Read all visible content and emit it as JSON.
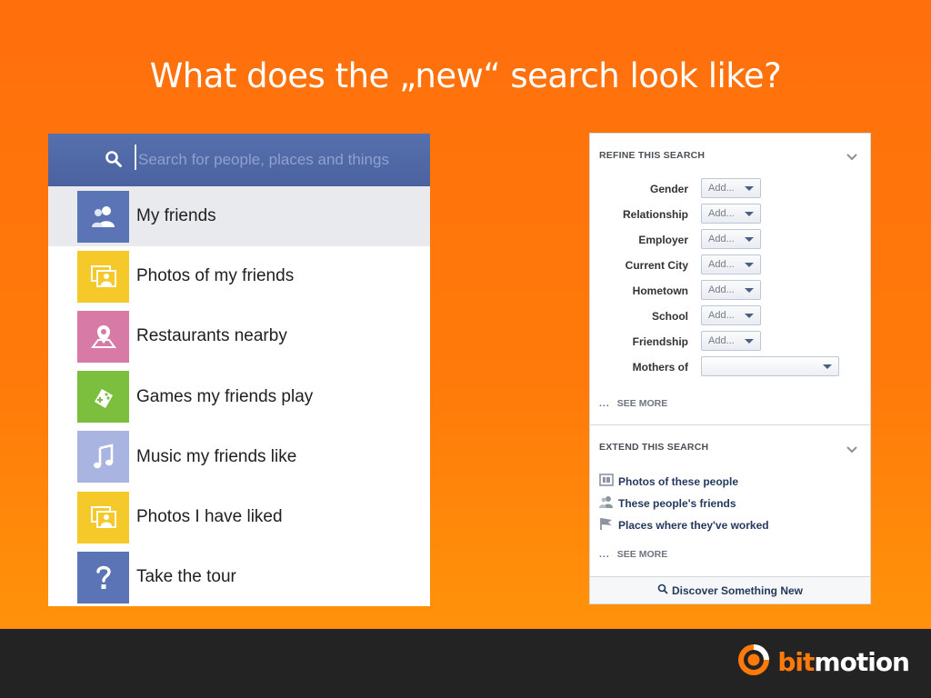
{
  "slide": {
    "title": "What does the „new“ search look like?"
  },
  "left_panel": {
    "search": {
      "placeholder": "Search for people, places and things",
      "value": ""
    },
    "results": [
      {
        "label": "My friends",
        "icon": "friends-icon",
        "color": "#5b74b5",
        "selected": true
      },
      {
        "label": "Photos of my friends",
        "icon": "photos-icon",
        "color": "#f5c92a",
        "selected": false
      },
      {
        "label": "Restaurants nearby",
        "icon": "map-pin-icon",
        "color": "#d77aa5",
        "selected": false
      },
      {
        "label": "Games my friends play",
        "icon": "game-controller-icon",
        "color": "#7cbf3f",
        "selected": false
      },
      {
        "label": "Music my friends like",
        "icon": "music-note-icon",
        "color": "#a9b4e0",
        "selected": false
      },
      {
        "label": "Photos I have liked",
        "icon": "photos-icon",
        "color": "#f5c92a",
        "selected": false
      },
      {
        "label": "Take the tour",
        "icon": "question-icon",
        "color": "#5b74b5",
        "selected": false
      }
    ]
  },
  "right_panel": {
    "refine": {
      "title": "REFINE THIS SEARCH",
      "filters": [
        {
          "label": "Gender",
          "value": "Add..."
        },
        {
          "label": "Relationship",
          "value": "Add..."
        },
        {
          "label": "Employer",
          "value": "Add..."
        },
        {
          "label": "Current City",
          "value": "Add..."
        },
        {
          "label": "Hometown",
          "value": "Add..."
        },
        {
          "label": "School",
          "value": "Add..."
        },
        {
          "label": "Friendship",
          "value": "Add..."
        },
        {
          "label": "Mothers of",
          "value": ""
        }
      ],
      "see_more": "SEE MORE",
      "dots": "..."
    },
    "extend": {
      "title": "EXTEND THIS SEARCH",
      "items": [
        {
          "label": "Photos of these people",
          "icon": "photo-icon"
        },
        {
          "label": "These people's friends",
          "icon": "friends-icon"
        },
        {
          "label": "Places where they've worked",
          "icon": "flag-icon"
        }
      ],
      "see_more": "SEE MORE",
      "dots": "..."
    },
    "discover": {
      "label": "Discover Something New"
    }
  },
  "footer": {
    "logo_bit": "bit",
    "logo_motion": "motion"
  }
}
